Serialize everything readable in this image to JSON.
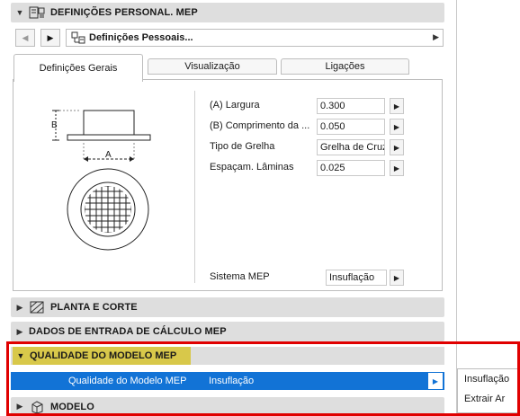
{
  "settings_header": {
    "title": "DEFINIÇÕES PERSONAL. MEP"
  },
  "nav": {
    "selected": "Definições Pessoais..."
  },
  "tabs": [
    {
      "label": "Definições Gerais"
    },
    {
      "label": "Visualização"
    },
    {
      "label": "Ligações"
    }
  ],
  "diagram": {
    "dim_a": "A",
    "dim_b": "B"
  },
  "params": {
    "largura": {
      "label": "(A) Largura",
      "value": "0.300"
    },
    "comprimento": {
      "label": "(B) Comprimento da ...",
      "value": "0.050"
    },
    "tipo_grelha": {
      "label": "Tipo de Grelha",
      "value": "Grelha de Cruz"
    },
    "espacamento": {
      "label": "Espaçam. Lâminas",
      "value": "0.025"
    },
    "sistema": {
      "label": "Sistema MEP",
      "value": "Insuflação"
    }
  },
  "sections": {
    "planta": "PLANTA E CORTE",
    "dados": "DADOS DE ENTRADA DE CÁLCULO MEP",
    "qualidade": "QUALIDADE DO MODELO MEP",
    "modelo": "MODELO"
  },
  "quality_row": {
    "label": "Qualidade do Modelo MEP",
    "value": "Insuflação"
  },
  "dropdown": {
    "options": [
      "Insuflação",
      "Extrair Ar"
    ]
  },
  "colors": {
    "highlight_red": "#e00000",
    "selection_blue": "#1273d6",
    "header_yellow": "#d8c84a"
  }
}
